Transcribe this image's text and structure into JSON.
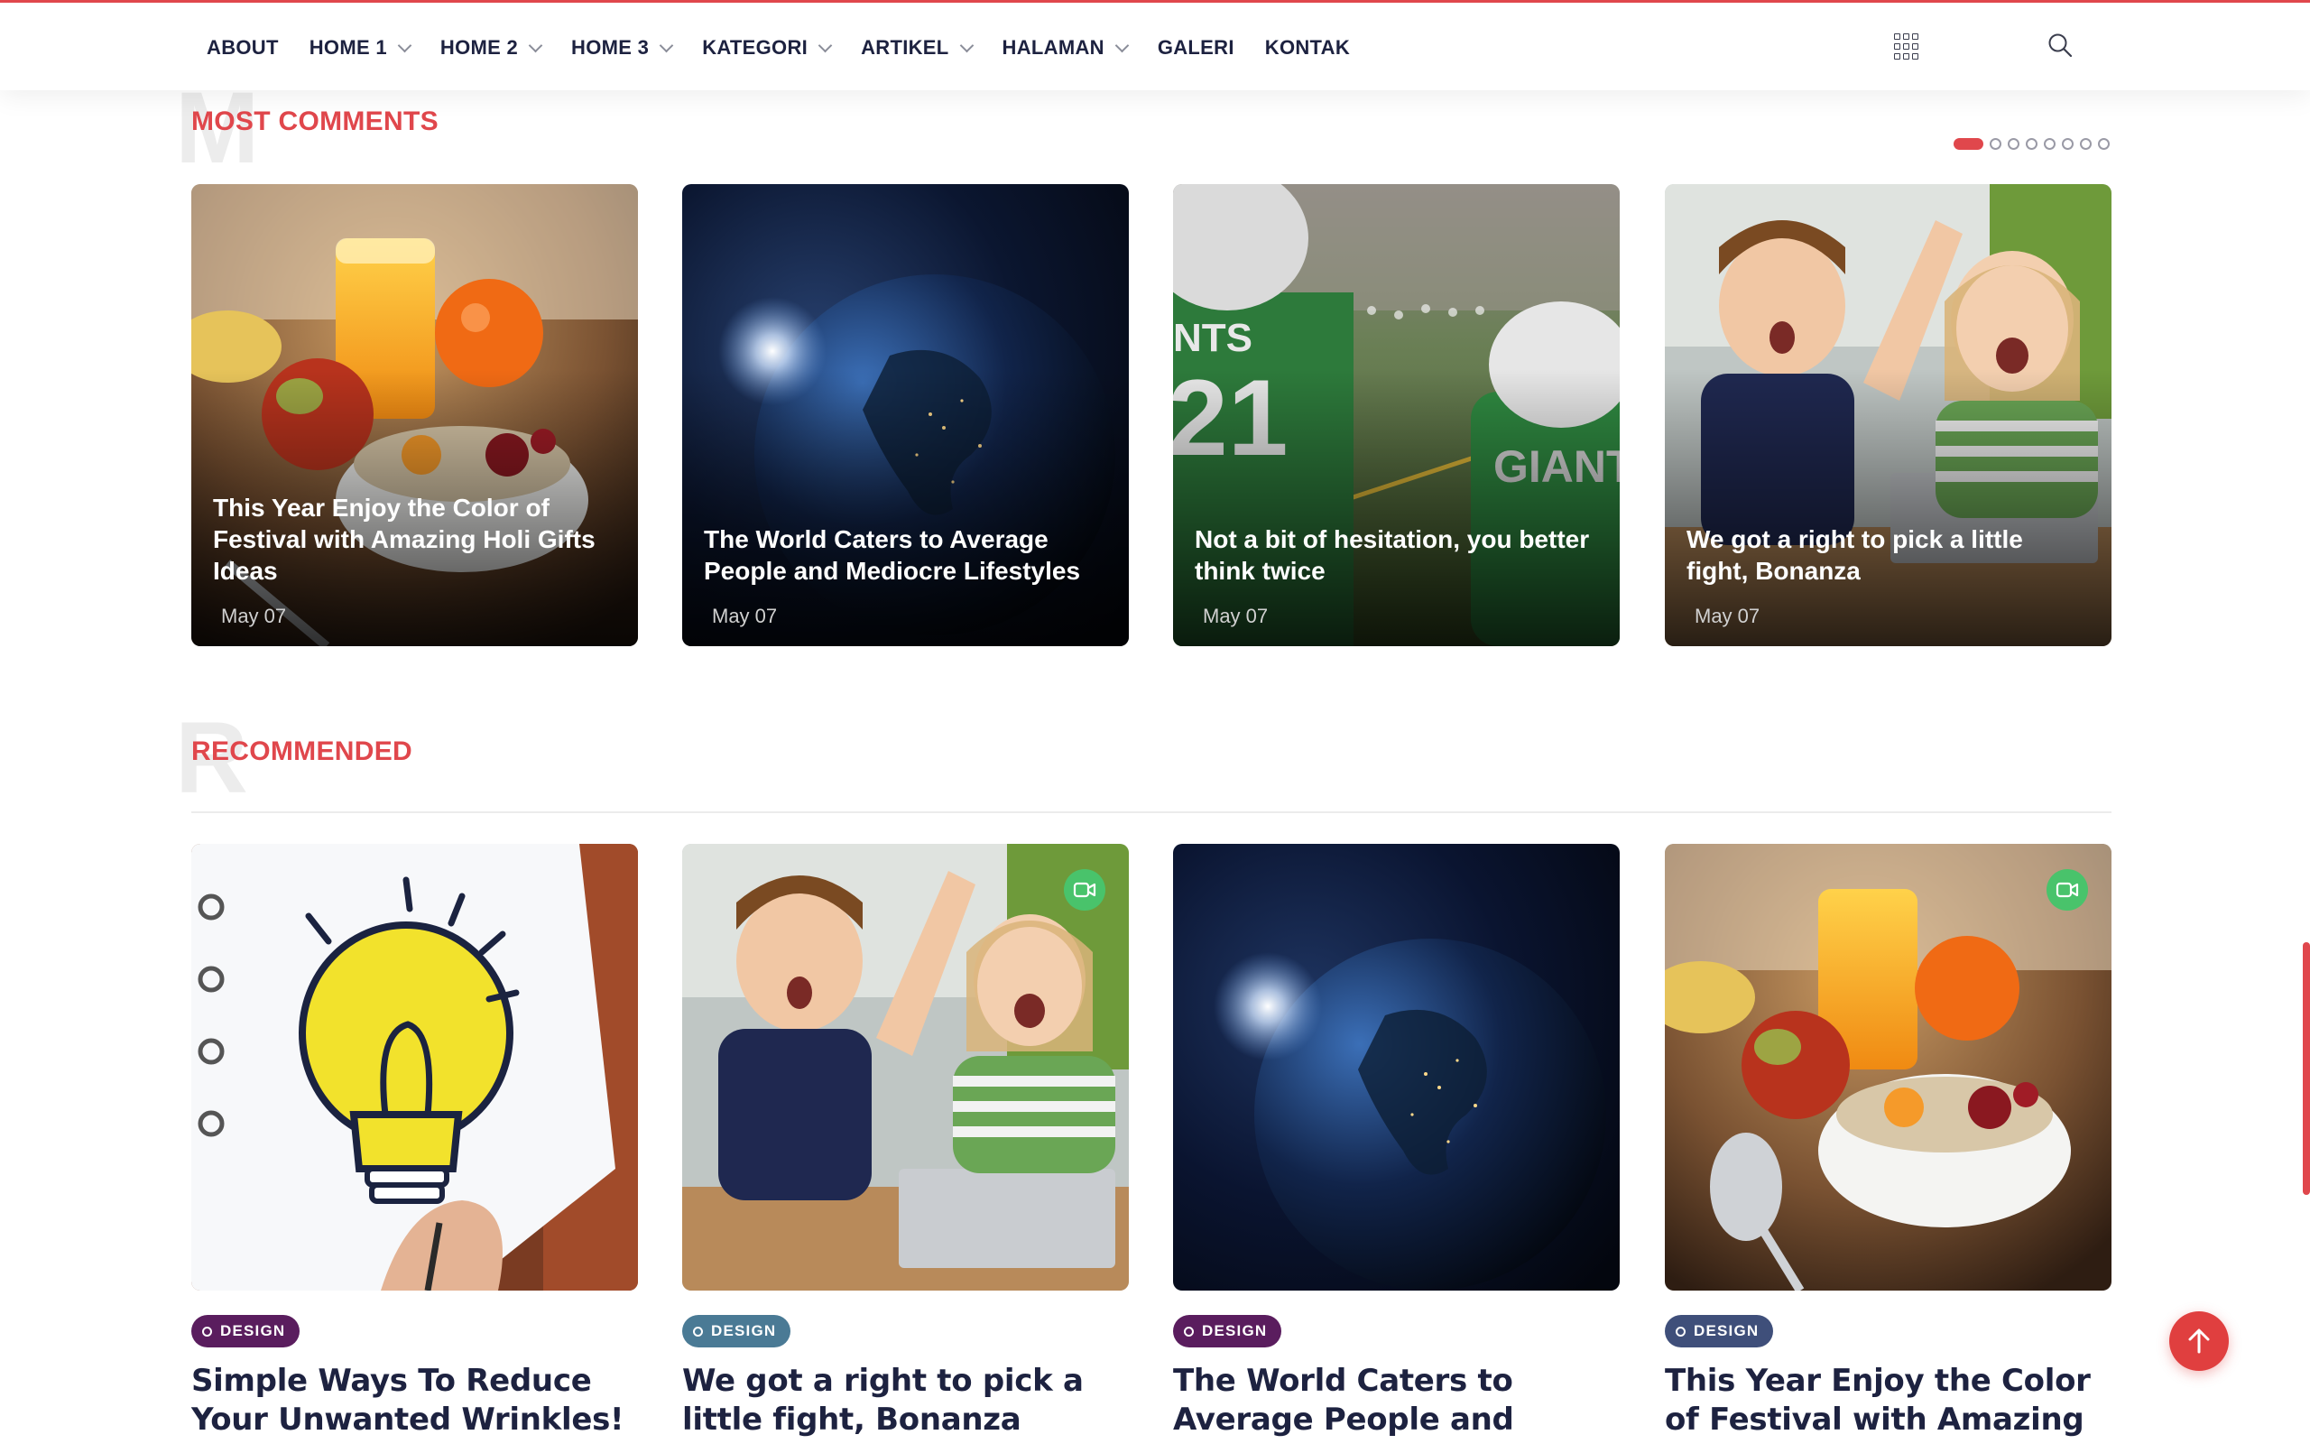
{
  "nav": {
    "items": [
      {
        "label": "ABOUT",
        "dropdown": false
      },
      {
        "label": "HOME 1",
        "dropdown": true
      },
      {
        "label": "HOME 2",
        "dropdown": true
      },
      {
        "label": "HOME 3",
        "dropdown": true
      },
      {
        "label": "KATEGORI",
        "dropdown": true
      },
      {
        "label": "ARTIKEL",
        "dropdown": true
      },
      {
        "label": "HALAMAN",
        "dropdown": true
      },
      {
        "label": "GALERI",
        "dropdown": false
      },
      {
        "label": "KONTAK",
        "dropdown": false
      }
    ],
    "grid_icon": "grid-menu-icon",
    "search_icon": "search-icon"
  },
  "most_comments": {
    "letter": "M",
    "title": "MOST COMMENTS",
    "slider_dots": 8,
    "active_dot": 1,
    "cards": [
      {
        "title": "This Year Enjoy the Color of Festival with Amazing Holi Gifts Ideas",
        "date": "May 07",
        "image": "breakfast"
      },
      {
        "title": "The World Caters to Average People and Mediocre Lifestyles",
        "date": "May 07",
        "image": "earth"
      },
      {
        "title": "Not a bit of hesitation, you better think twice",
        "date": "May 07",
        "image": "football"
      },
      {
        "title": "We got a right to pick a little fight, Bonanza",
        "date": "May 07",
        "image": "kids"
      }
    ]
  },
  "recommended": {
    "letter": "R",
    "title": "RECOMMENDED",
    "cards": [
      {
        "category": "DESIGN",
        "tag_color": "#5a1d5e",
        "title": "Simple Ways To Reduce Your Unwanted Wrinkles!",
        "image": "bulb",
        "video": false
      },
      {
        "category": "DESIGN",
        "tag_color": "#4a7a95",
        "title": "We got a right to pick a little fight, Bonanza",
        "image": "kids",
        "video": true
      },
      {
        "category": "DESIGN",
        "tag_color": "#5a1d5e",
        "title": "The World Caters to Average People and Mediocre Lifestyles",
        "image": "earth",
        "video": false
      },
      {
        "category": "DESIGN",
        "tag_color": "#3f4f7a",
        "title": "This Year Enjoy the Color of Festival with Amazing Holi",
        "image": "breakfast",
        "video": true
      }
    ]
  },
  "colors": {
    "accent": "#e0474c",
    "video_badge": "#49c36b",
    "heading": "#1d2240"
  },
  "scroll_top_icon": "arrow-up-icon"
}
